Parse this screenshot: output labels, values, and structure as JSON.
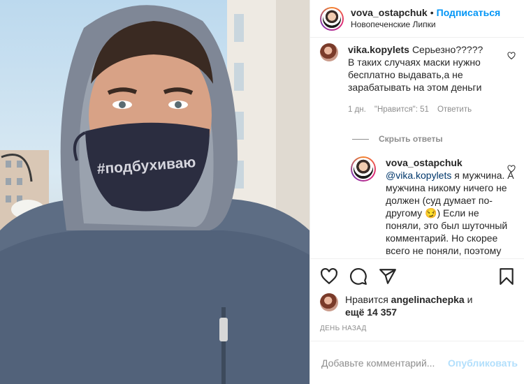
{
  "header": {
    "username": "vova_ostapchuk",
    "separator": "•",
    "follow_label": "Подписаться",
    "location": "Новопеченские Липки"
  },
  "photo": {
    "mask_text": "#подбухиваю"
  },
  "comments": [
    {
      "user": "vika.kopylets",
      "text": "Серьезно?????В таких случаях маски нужно бесплатно выдавать,а не зарабатывать на этом деньги",
      "time": "1 дн.",
      "likes": "\"Нравится\": 51",
      "reply_label": "Ответить"
    }
  ],
  "hide_replies_label": "Скрыть ответы",
  "reply": {
    "user": "vova_ostapchuk",
    "mention": "@vika.kopylets",
    "text": "я мужчина. А мужчина никому ничего не должен (суд думает по-другому 😏) Если не поняли, это был шуточный комментарий. Но скорее всего не поняли, поэтому будете"
  },
  "likes": {
    "prefix": "Нравится",
    "user": "angelinachepka",
    "suffix": "и",
    "count_text": "ещё 14 357"
  },
  "date": "ДЕНЬ НАЗАД",
  "add_comment": {
    "placeholder": "Добавьте комментарий...",
    "publish_label": "Опубликовать"
  },
  "colors": {
    "accent": "#0095f6",
    "publish_disabled": "#b2dffc",
    "secondary_text": "#8e8e8e",
    "border": "#efefef"
  }
}
